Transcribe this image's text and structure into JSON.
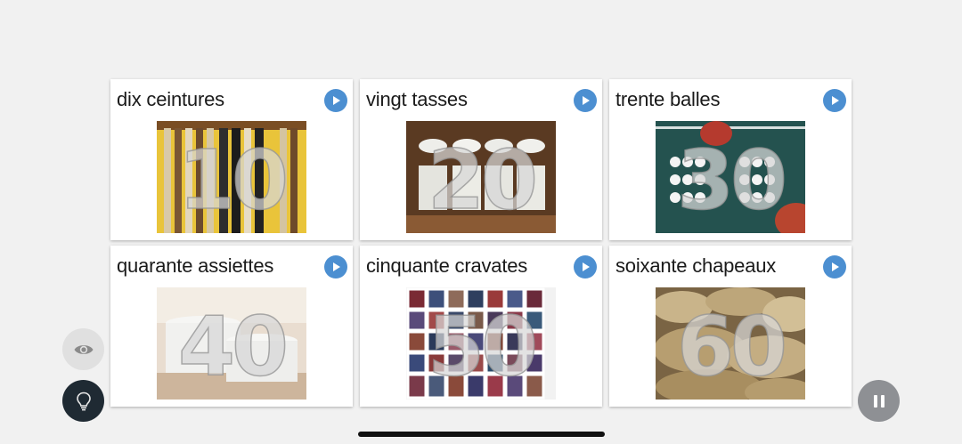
{
  "cards": [
    {
      "title": "dix ceintures",
      "numeral": "10",
      "icon": "belts-photo"
    },
    {
      "title": "vingt tasses",
      "numeral": "20",
      "icon": "cups-photo"
    },
    {
      "title": "trente balles",
      "numeral": "30",
      "icon": "ping-pong-balls-photo"
    },
    {
      "title": "quarante assiettes",
      "numeral": "40",
      "icon": "plates-photo"
    },
    {
      "title": "cinquante cravates",
      "numeral": "50",
      "icon": "ties-photo"
    },
    {
      "title": "soixante chapeaux",
      "numeral": "60",
      "icon": "straw-hats-photo"
    }
  ],
  "controls": {
    "eye": "eye-icon",
    "hint": "lightbulb-icon",
    "pause": "pause-icon"
  },
  "colors": {
    "accent": "#4c8fd1",
    "background": "#f1f1f1",
    "card": "#ffffff"
  }
}
